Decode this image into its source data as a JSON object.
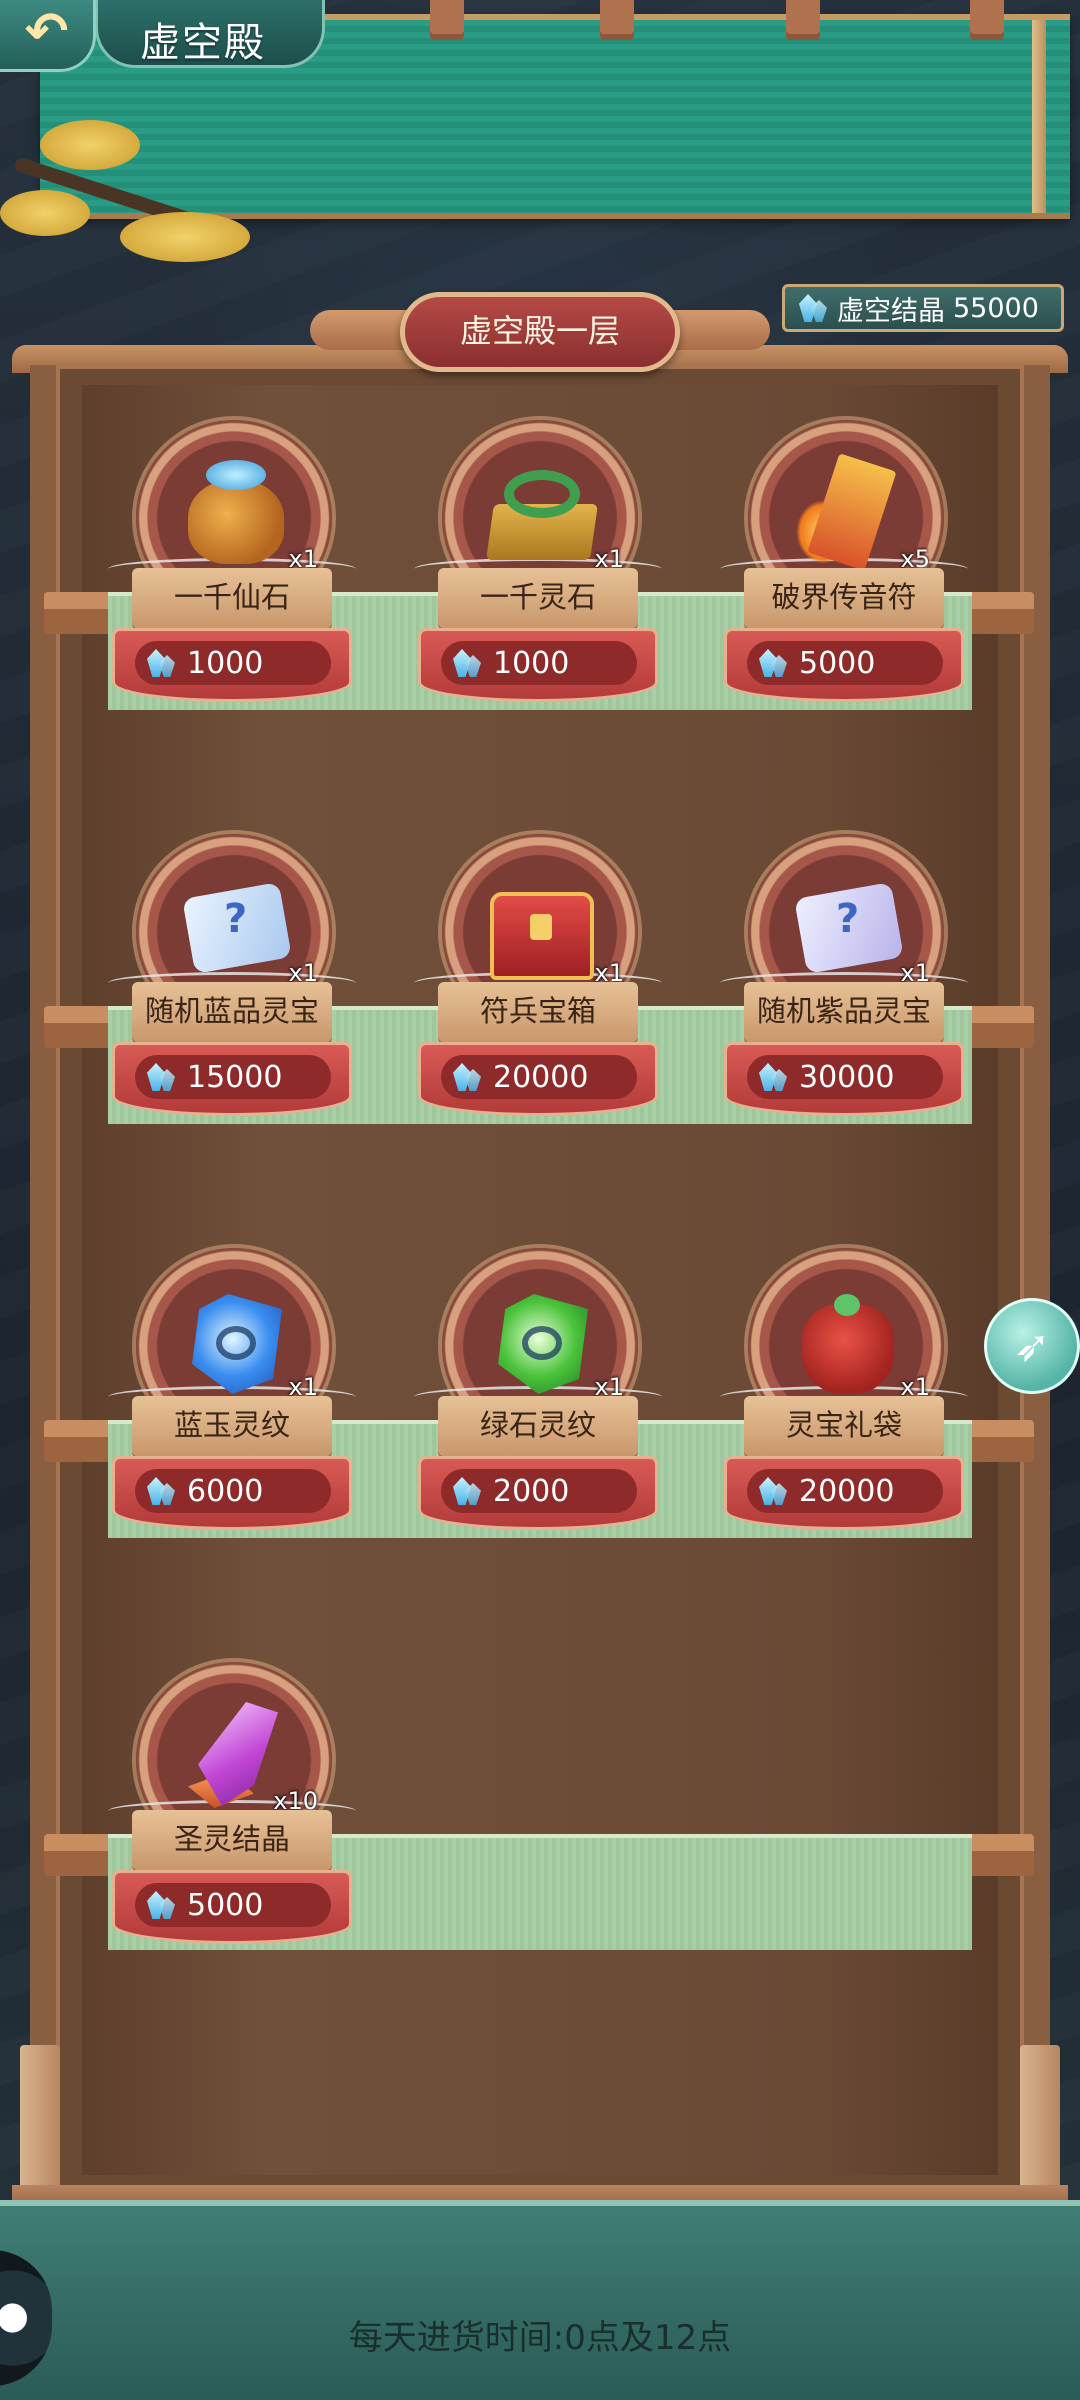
{
  "header": {
    "title": "虚空殿",
    "back_icon": "back-arrow-icon"
  },
  "currency": {
    "label": "虚空结晶",
    "amount": "55000",
    "icon": "crystal-icon"
  },
  "floor": {
    "label": "虚空殿一层"
  },
  "items": [
    {
      "name": "一千仙石",
      "qty": "x1",
      "price": "1000",
      "icon": "money-bag-icon"
    },
    {
      "name": "一千灵石",
      "qty": "x1",
      "price": "1000",
      "icon": "jade-chest-icon"
    },
    {
      "name": "破界传音符",
      "qty": "x5",
      "price": "5000",
      "icon": "talisman-icon"
    },
    {
      "name": "随机蓝品灵宝",
      "qty": "x1",
      "price": "15000",
      "icon": "blue-scroll-icon"
    },
    {
      "name": "符兵宝箱",
      "qty": "x1",
      "price": "20000",
      "icon": "treasure-chest-icon"
    },
    {
      "name": "随机紫品灵宝",
      "qty": "x1",
      "price": "30000",
      "icon": "purple-scroll-icon"
    },
    {
      "name": "蓝玉灵纹",
      "qty": "x1",
      "price": "6000",
      "icon": "blue-gem-icon"
    },
    {
      "name": "绿石灵纹",
      "qty": "x1",
      "price": "2000",
      "icon": "green-gem-icon"
    },
    {
      "name": "灵宝礼袋",
      "qty": "x1",
      "price": "20000",
      "icon": "gift-bag-icon"
    },
    {
      "name": "圣灵结晶",
      "qty": "x10",
      "price": "5000",
      "icon": "purple-crystal-icon"
    }
  ],
  "side_button": {
    "icon": "rocket-icon"
  },
  "footer": {
    "restock_text": "每天进货时间:0点及12点"
  }
}
